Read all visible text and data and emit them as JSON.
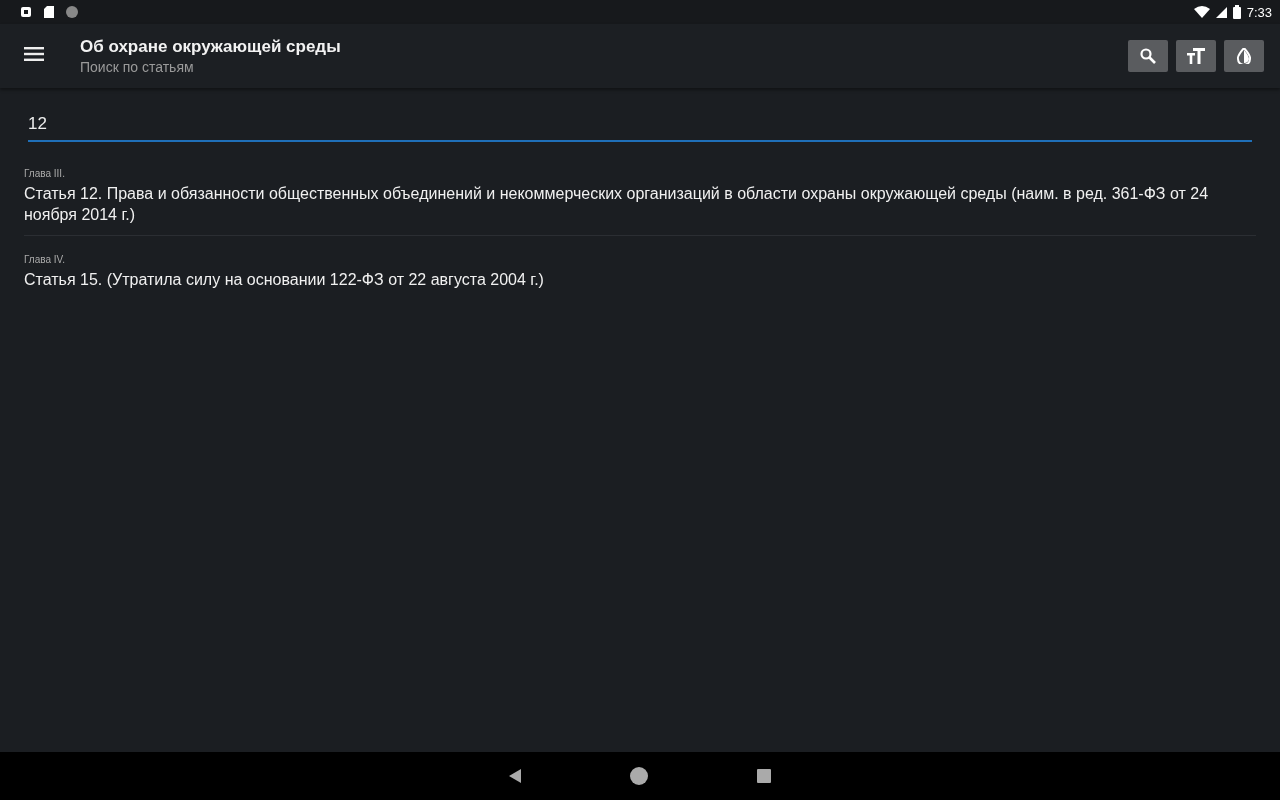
{
  "status_bar": {
    "time": "7:33"
  },
  "toolbar": {
    "title": "Об охране окружающей среды",
    "subtitle": "Поиск по статьям"
  },
  "search": {
    "value": "12"
  },
  "results": [
    {
      "chapter": "Глава III.",
      "title": "Статья 12. Права и обязанности общественных объединений и некоммерческих организаций в области охраны окружающей среды (наим. в ред. 361-ФЗ от 24 ноября 2014 г.)"
    },
    {
      "chapter": "Глава IV.",
      "title": "Статья 15. (Утратила силу на основании 122-ФЗ от 22 августа 2004 г.)"
    }
  ]
}
